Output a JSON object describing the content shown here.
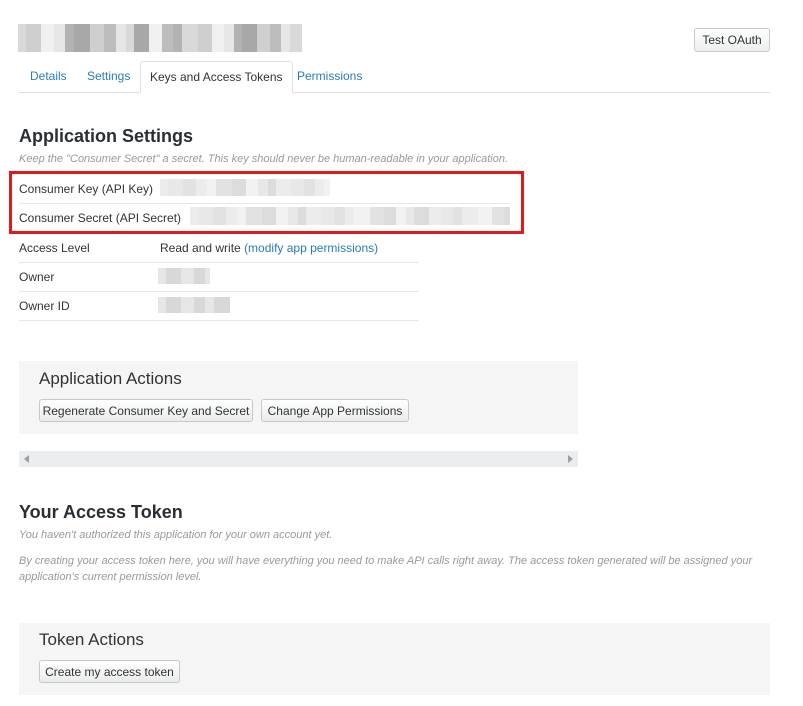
{
  "header": {
    "test_oauth_label": "Test OAuth"
  },
  "tabs": [
    {
      "label": "Details"
    },
    {
      "label": "Settings"
    },
    {
      "label": "Keys and Access Tokens"
    },
    {
      "label": "Permissions"
    }
  ],
  "app_settings": {
    "title": "Application Settings",
    "hint": "Keep the \"Consumer Secret\" a secret. This key should never be human-readable in your application.",
    "rows": [
      {
        "label": "Consumer Key (API Key)",
        "value": ""
      },
      {
        "label": "Consumer Secret (API Secret)",
        "value": ""
      },
      {
        "label": "Access Level",
        "value": "Read and write",
        "link": "(modify app permissions)"
      },
      {
        "label": "Owner",
        "value": ""
      },
      {
        "label": "Owner ID",
        "value": ""
      }
    ]
  },
  "app_actions": {
    "title": "Application Actions",
    "regenerate_label": "Regenerate Consumer Key and Secret",
    "change_perms_label": "Change App Permissions"
  },
  "access_token": {
    "title": "Your Access Token",
    "hint1": "You haven't authorized this application for your own account yet.",
    "hint2": "By creating your access token here, you will have everything you need to make API calls right away. The access token generated will be assigned your application's current permission level."
  },
  "token_actions": {
    "title": "Token Actions",
    "create_label": "Create my access token"
  },
  "colors": {
    "accent": "#2b7bb9",
    "highlight": "#e3181b",
    "panel": "#f5f5f5"
  }
}
